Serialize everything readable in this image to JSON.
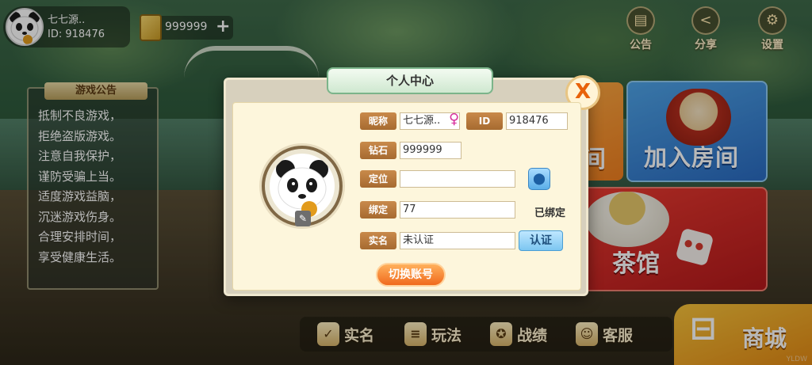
{
  "profile": {
    "name": "七七源..",
    "id_label": "ID: 918476"
  },
  "currency": {
    "diamonds": "999999",
    "add_symbol": "+"
  },
  "top_buttons": [
    {
      "label": "公告",
      "icon": "notice-icon"
    },
    {
      "label": "分享",
      "icon": "share-icon"
    },
    {
      "label": "设置",
      "icon": "gear-icon"
    }
  ],
  "notice_board": {
    "title": "游戏公告",
    "lines": [
      "抵制不良游戏，",
      "拒绝盗版游戏。",
      "注意自我保护，",
      "谨防受骗上当。",
      "适度游戏益脑，",
      "沉迷游戏伤身。",
      "合理安排时间，",
      "享受健康生活。"
    ]
  },
  "tiles": {
    "create_room_partial": "间",
    "join_room": "加入房间",
    "tea_house": "茶馆"
  },
  "bottom_nav": [
    {
      "label": "实名",
      "icon": "shield-check-icon"
    },
    {
      "label": "玩法",
      "icon": "rules-document-icon"
    },
    {
      "label": "战绩",
      "icon": "medal-icon"
    },
    {
      "label": "客服",
      "icon": "customer-service-icon"
    }
  ],
  "shop": {
    "label": "商城"
  },
  "modal": {
    "title": "个人中心",
    "close_symbol": "X",
    "nickname_label": "昵称",
    "nickname_value": "七七源..",
    "gender_symbol": "♀",
    "id_label": "ID",
    "id_value": "918476",
    "diamond_label": "钻石",
    "diamond_value": "999999",
    "location_label": "定位",
    "location_value": "",
    "bind_label": "绑定",
    "bind_value": "77",
    "bind_status": "已绑定",
    "realname_label": "实名",
    "realname_value": "未认证",
    "verify_button": "认证",
    "switch_account_button": "切换账号"
  },
  "watermark": "YLDW"
}
